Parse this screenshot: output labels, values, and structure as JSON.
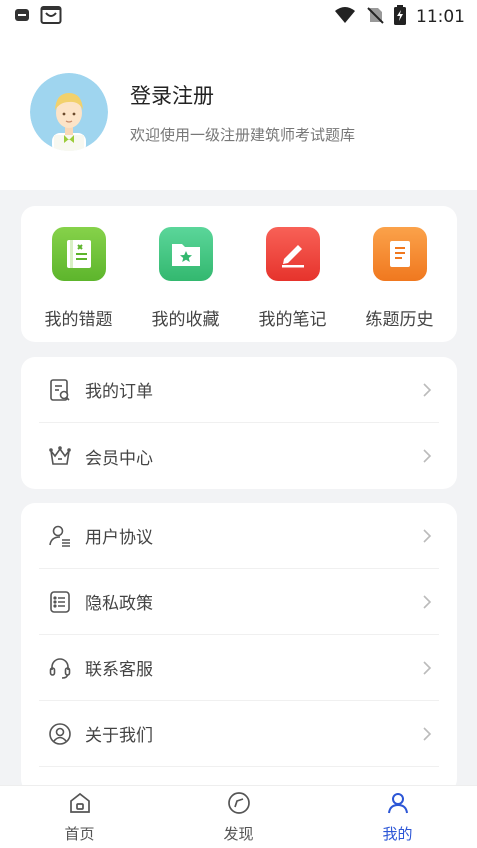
{
  "status_bar": {
    "time": "11:01"
  },
  "profile": {
    "name": "登录注册",
    "subtitle": "欢迎使用一级注册建筑师考试题库"
  },
  "quick_actions": [
    {
      "label": "我的错题",
      "icon": "wrong-questions-icon",
      "color": "#6cc13b"
    },
    {
      "label": "我的收藏",
      "icon": "favorites-folder-icon",
      "color": "#3ec57e"
    },
    {
      "label": "我的笔记",
      "icon": "notes-pen-icon",
      "color": "#f0473f"
    },
    {
      "label": "练题历史",
      "icon": "history-book-icon",
      "color": "#f68a2e"
    }
  ],
  "menu_group1": [
    {
      "label": "我的订单",
      "icon": "order-icon"
    },
    {
      "label": "会员中心",
      "icon": "crown-icon"
    }
  ],
  "menu_group2": [
    {
      "label": "用户协议",
      "icon": "user-agreement-icon"
    },
    {
      "label": "隐私政策",
      "icon": "privacy-policy-icon"
    },
    {
      "label": "联系客服",
      "icon": "headset-icon"
    },
    {
      "label": "关于我们",
      "icon": "about-us-icon"
    }
  ],
  "tabbar": {
    "home": "首页",
    "discover": "发现",
    "mine": "我的",
    "active_color": "#2c56d6"
  }
}
